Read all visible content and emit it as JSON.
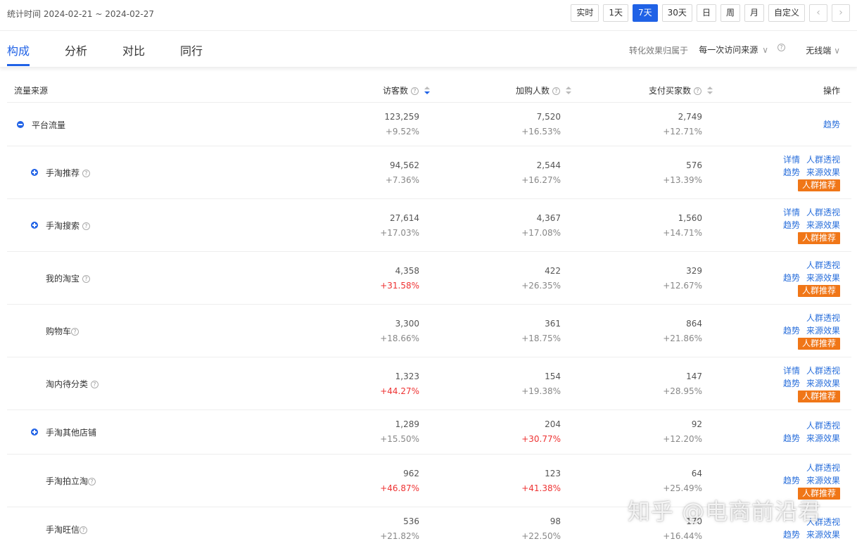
{
  "stat_time": "统计时间 2024-02-21 ~ 2024-02-27",
  "range_buttons": [
    "实时",
    "1天",
    "7天",
    "30天",
    "日",
    "周",
    "月",
    "自定义"
  ],
  "range_active": "7天",
  "nav_prev": "‹",
  "nav_next": "›",
  "tabs": [
    "构成",
    "分析",
    "对比",
    "同行"
  ],
  "attr_label": "转化效果归属于",
  "attr_select": "每一次访问来源",
  "wireless": "无线端",
  "chevron": "∨",
  "help": "?",
  "columns": {
    "source": "流量来源",
    "visitors": "访客数",
    "cart": "加购人数",
    "buyers": "支付买家数",
    "ops": "操作"
  },
  "ops_labels": {
    "detail": "详情",
    "crowd": "人群透视",
    "trend": "趋势",
    "source_effect": "来源效果",
    "crowd_recommend": "人群推荐"
  },
  "rows": [
    {
      "name": "平台流量",
      "visitors": "123,259",
      "visitors_chg": "+9.52%",
      "cart": "7,520",
      "cart_chg": "+16.53%",
      "buyers": "2,749",
      "buyers_chg": "+12.71%"
    },
    {
      "name": "手淘推荐",
      "visitors": "94,562",
      "visitors_chg": "+7.36%",
      "cart": "2,544",
      "cart_chg": "+16.27%",
      "buyers": "576",
      "buyers_chg": "+13.39%"
    },
    {
      "name": "手淘搜索",
      "visitors": "27,614",
      "visitors_chg": "+17.03%",
      "cart": "4,367",
      "cart_chg": "+17.08%",
      "buyers": "1,560",
      "buyers_chg": "+14.71%"
    },
    {
      "name": "我的淘宝",
      "visitors": "4,358",
      "visitors_chg": "+31.58%",
      "cart": "422",
      "cart_chg": "+26.35%",
      "buyers": "329",
      "buyers_chg": "+12.67%"
    },
    {
      "name": "购物车",
      "visitors": "3,300",
      "visitors_chg": "+18.66%",
      "cart": "361",
      "cart_chg": "+18.75%",
      "buyers": "864",
      "buyers_chg": "+21.86%"
    },
    {
      "name": "淘内待分类",
      "visitors": "1,323",
      "visitors_chg": "+44.27%",
      "cart": "154",
      "cart_chg": "+19.38%",
      "buyers": "147",
      "buyers_chg": "+28.95%"
    },
    {
      "name": "手淘其他店铺",
      "visitors": "1,289",
      "visitors_chg": "+15.50%",
      "cart": "204",
      "cart_chg": "+30.77%",
      "buyers": "92",
      "buyers_chg": "+12.20%"
    },
    {
      "name": "手淘拍立淘",
      "visitors": "962",
      "visitors_chg": "+46.87%",
      "cart": "123",
      "cart_chg": "+41.38%",
      "buyers": "64",
      "buyers_chg": "+25.49%"
    },
    {
      "name": "手淘旺信",
      "visitors": "536",
      "visitors_chg": "+21.82%",
      "cart": "98",
      "cart_chg": "+22.50%",
      "buyers": "170",
      "buyers_chg": "+16.44%"
    }
  ],
  "watermark": "知乎 @电商前沿君",
  "colors": {
    "accent": "#2062e6",
    "up_red": "#e33333",
    "badge_orange": "#f07617",
    "link": "#2a6fdb"
  }
}
